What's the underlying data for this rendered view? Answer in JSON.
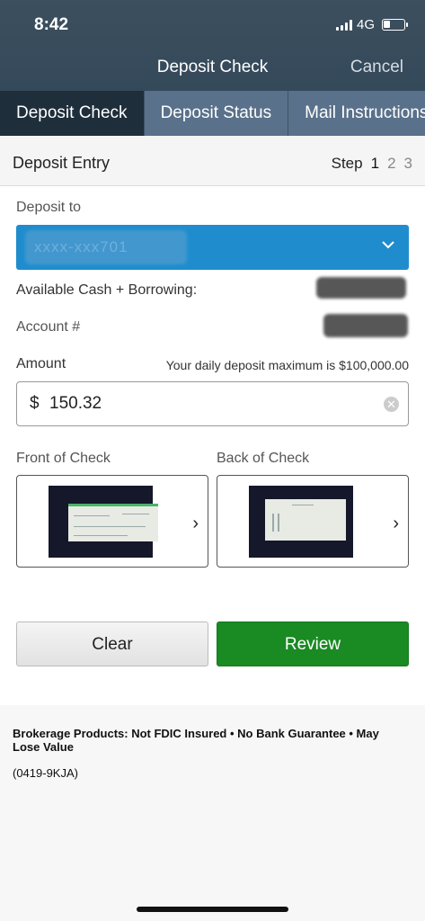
{
  "status_bar": {
    "time": "8:42",
    "network": "4G",
    "icons": [
      "signal-icon",
      "battery-icon"
    ]
  },
  "nav": {
    "title": "Deposit Check",
    "cancel_label": "Cancel"
  },
  "tabs": [
    {
      "label": "Deposit Check",
      "active": true
    },
    {
      "label": "Deposit Status",
      "active": false
    },
    {
      "label": "Mail Instructions",
      "active": false
    }
  ],
  "entry": {
    "title": "Deposit Entry",
    "step_label": "Step",
    "steps": [
      "1",
      "2",
      "3"
    ],
    "current_step": "1"
  },
  "form": {
    "deposit_to_label": "Deposit to",
    "deposit_to_value": "xxxx-xxx701",
    "available_label": "Available Cash + Borrowing:",
    "account_label": "Account #",
    "amount_label": "Amount",
    "amount_hint": "Your daily deposit maximum is $100,000.00",
    "amount_currency": "$",
    "amount_value": "150.32",
    "front_label": "Front of Check",
    "back_label": "Back of Check"
  },
  "buttons": {
    "clear": "Clear",
    "review": "Review"
  },
  "footer": {
    "disclaimer": "Brokerage Products: Not FDIC Insured • No Bank Guarantee • May Lose Value",
    "code": "(0419-9KJA)"
  },
  "colors": {
    "nav": "#34495a",
    "tab_bar": "#59718a",
    "tab_active": "#1f2e3b",
    "select": "#1f8dcd",
    "review": "#1a8a23"
  }
}
